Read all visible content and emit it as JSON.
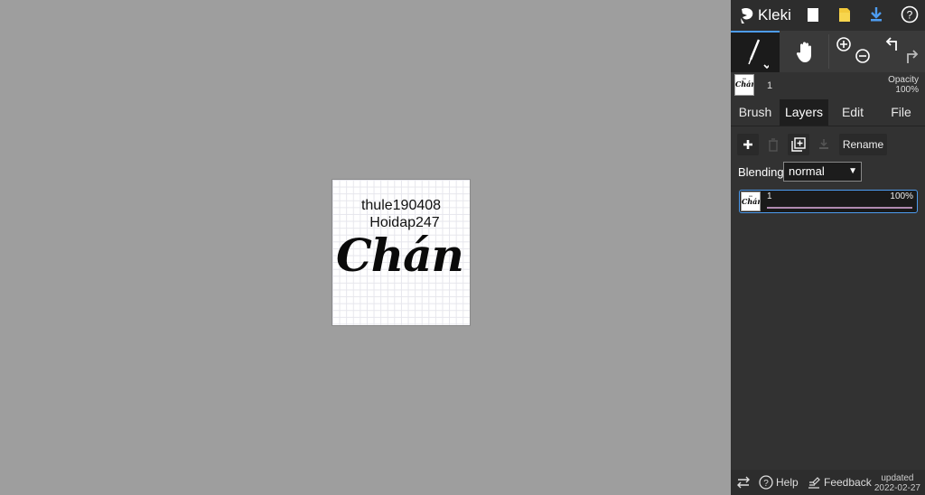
{
  "app": {
    "name": "Kleki"
  },
  "canvas": {
    "text_line1": "thule190408",
    "text_line2": "Hoidap247",
    "script_text": "Chán"
  },
  "layer_preview": {
    "layer_number": "1",
    "opacity_label": "Opacity",
    "opacity_value": "100%"
  },
  "tabs": [
    {
      "label": "Brush"
    },
    {
      "label": "Layers"
    },
    {
      "label": "Edit"
    },
    {
      "label": "File"
    }
  ],
  "layers_panel": {
    "rename_label": "Rename",
    "blending_label": "Blending",
    "blending_value": "normal",
    "layers": [
      {
        "name": "1",
        "opacity": "100%"
      }
    ]
  },
  "footer": {
    "help_label": "Help",
    "feedback_label": "Feedback",
    "updated_label": "updated",
    "updated_date": "2022-02-27"
  },
  "icons": [
    "kleki-logo-icon",
    "new-image-icon",
    "open-folder-icon",
    "download-icon",
    "help-icon",
    "brush-icon",
    "hand-icon",
    "zoom-in-icon",
    "zoom-out-icon",
    "undo-icon",
    "redo-icon",
    "add-layer-icon",
    "delete-layer-icon",
    "duplicate-layer-icon",
    "merge-layer-icon",
    "swap-icon",
    "help-circle-icon",
    "feedback-icon"
  ],
  "colors": {
    "accent": "#4d9cf0",
    "panel": "#323232",
    "canvas_bg": "#9e9e9e"
  }
}
